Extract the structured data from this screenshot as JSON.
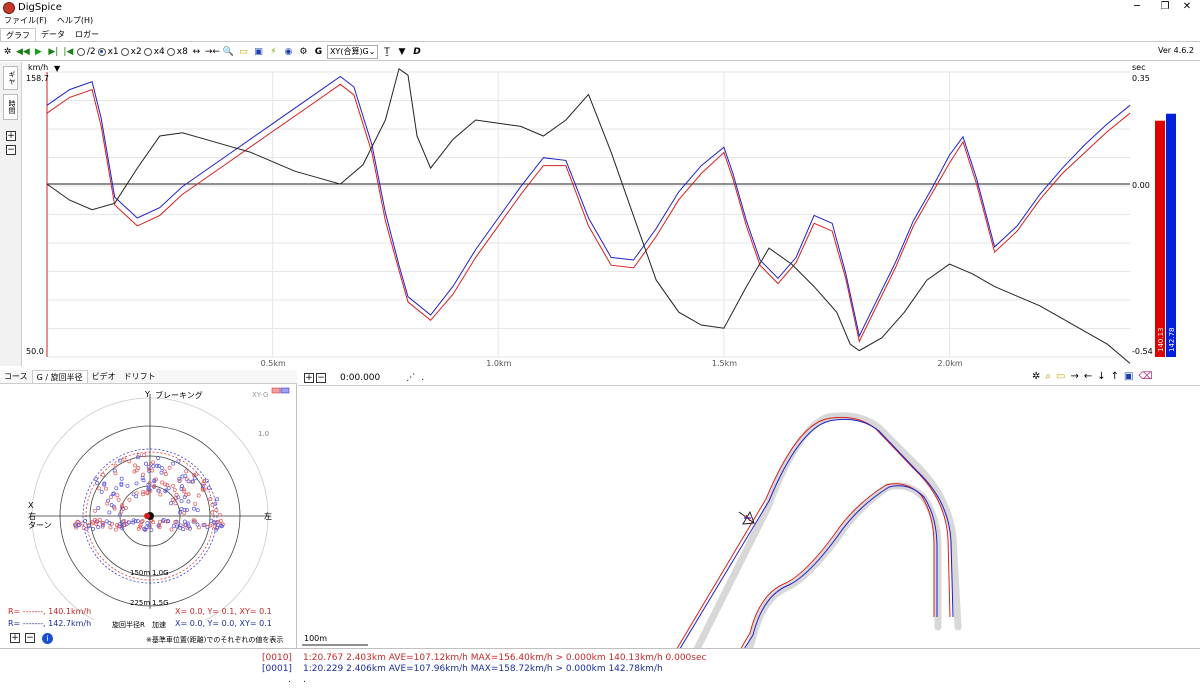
{
  "window": {
    "title": "DigSpice",
    "minimize": "─",
    "maximize": "❐",
    "close": "✕"
  },
  "menu": [
    {
      "label": "ファイル(F)"
    },
    {
      "label": "ヘルプ(H)"
    }
  ],
  "tabs": [
    {
      "label": "グラフ"
    },
    {
      "label": "データ"
    },
    {
      "label": "ロガー"
    }
  ],
  "toolbar": {
    "speeds": [
      {
        "label": "/2",
        "selected": false
      },
      {
        "label": "x1",
        "selected": true
      },
      {
        "label": "x2",
        "selected": false
      },
      {
        "label": "x4",
        "selected": false
      },
      {
        "label": "x8",
        "selected": false
      }
    ],
    "g_label": "G",
    "xy_select": "XY(合算)G",
    "version": "Ver 4.6.2",
    "icons": [
      "reset-icon",
      "rewind-icon",
      "play-icon",
      "step-forward-icon",
      "step-back-icon",
      "fit-width-icon",
      "shrink-width-icon",
      "search-icon",
      "open-folder-icon",
      "save-icon",
      "magic-icon",
      "globe-icon",
      "settings-icon"
    ]
  },
  "graph": {
    "left_unit": "km/h",
    "left_top": "158.7",
    "left_bottom": "50.0",
    "right_unit": "sec",
    "right_top": "0.35",
    "right_mid": "0.00",
    "right_bottom": "-0.54",
    "side_tabs": [
      "ギヤ",
      "時間"
    ],
    "x_ticks": [
      "0.5km",
      "1.0km",
      "1.5km",
      "2.0km"
    ],
    "bar_red_label": "140.13",
    "bar_blue_label": "142.78",
    "colors": {
      "red": "#d62020",
      "blue": "#2020c8",
      "black": "#222222"
    }
  },
  "chart_data": {
    "type": "line",
    "xlabel": "",
    "ylabel": "km/h",
    "x_unit": "km",
    "xlim": [
      0,
      2.4
    ],
    "ylim": [
      50.0,
      158.7
    ],
    "y2lim": [
      -0.54,
      0.35
    ],
    "series": [
      {
        "name": "",
        "color": "#d62020",
        "axis": "speed",
        "x": [
          0,
          0.05,
          0.1,
          0.12,
          0.15,
          0.2,
          0.25,
          0.3,
          0.4,
          0.5,
          0.6,
          0.65,
          0.68,
          0.72,
          0.75,
          0.78,
          0.8,
          0.85,
          0.9,
          0.95,
          1.0,
          1.05,
          1.1,
          1.15,
          1.2,
          1.25,
          1.3,
          1.35,
          1.4,
          1.45,
          1.5,
          1.52,
          1.55,
          1.58,
          1.62,
          1.66,
          1.7,
          1.74,
          1.77,
          1.8,
          1.84,
          1.88,
          1.92,
          1.96,
          2.0,
          2.03,
          2.06,
          2.1,
          2.15,
          2.2,
          2.25,
          2.3,
          2.35,
          2.4
        ],
        "y": [
          143,
          149,
          152,
          138,
          108,
          100,
          104,
          112,
          124,
          136,
          148,
          154,
          150,
          128,
          102,
          83,
          71,
          64,
          74,
          88,
          100,
          112,
          123,
          123,
          100,
          85,
          84,
          96,
          110,
          120,
          128,
          118,
          100,
          85,
          78,
          86,
          101,
          98,
          80,
          56,
          70,
          84,
          100,
          112,
          124,
          132,
          116,
          90,
          98,
          110,
          120,
          128,
          136,
          143
        ]
      },
      {
        "name": "",
        "color": "#2020c8",
        "axis": "speed",
        "x": [
          0,
          0.05,
          0.1,
          0.12,
          0.15,
          0.2,
          0.25,
          0.3,
          0.4,
          0.5,
          0.6,
          0.65,
          0.68,
          0.72,
          0.75,
          0.78,
          0.8,
          0.85,
          0.9,
          0.95,
          1.0,
          1.05,
          1.1,
          1.15,
          1.2,
          1.25,
          1.3,
          1.35,
          1.4,
          1.45,
          1.5,
          1.52,
          1.55,
          1.58,
          1.62,
          1.66,
          1.7,
          1.74,
          1.77,
          1.8,
          1.84,
          1.88,
          1.92,
          1.96,
          2.0,
          2.03,
          2.06,
          2.1,
          2.15,
          2.2,
          2.25,
          2.3,
          2.35,
          2.4
        ],
        "y": [
          146,
          152,
          155,
          141,
          111,
          103,
          107,
          115,
          127,
          139,
          151,
          157,
          153,
          131,
          105,
          85,
          73,
          66,
          77,
          91,
          103,
          115,
          126,
          125,
          103,
          88,
          87,
          99,
          113,
          123,
          130,
          120,
          102,
          87,
          80,
          88,
          104,
          101,
          82,
          58,
          72,
          86,
          102,
          114,
          127,
          134,
          118,
          92,
          100,
          112,
          122,
          131,
          139,
          146
        ]
      },
      {
        "name": "",
        "color": "#222222",
        "axis": "time",
        "x": [
          0,
          0.05,
          0.1,
          0.15,
          0.2,
          0.25,
          0.3,
          0.35,
          0.4,
          0.45,
          0.5,
          0.55,
          0.6,
          0.65,
          0.7,
          0.75,
          0.78,
          0.8,
          0.82,
          0.85,
          0.9,
          0.95,
          1.0,
          1.05,
          1.1,
          1.15,
          1.2,
          1.25,
          1.3,
          1.35,
          1.4,
          1.45,
          1.5,
          1.55,
          1.6,
          1.65,
          1.7,
          1.75,
          1.78,
          1.8,
          1.85,
          1.9,
          1.95,
          2.0,
          2.05,
          2.1,
          2.15,
          2.2,
          2.25,
          2.3,
          2.35,
          2.4
        ],
        "y": [
          0.0,
          -0.05,
          -0.08,
          -0.06,
          0.05,
          0.15,
          0.16,
          0.14,
          0.12,
          0.1,
          0.07,
          0.04,
          0.02,
          0.0,
          0.06,
          0.2,
          0.36,
          0.34,
          0.15,
          0.05,
          0.14,
          0.2,
          0.19,
          0.18,
          0.15,
          0.2,
          0.28,
          0.1,
          -0.1,
          -0.3,
          -0.4,
          -0.44,
          -0.45,
          -0.32,
          -0.2,
          -0.25,
          -0.32,
          -0.4,
          -0.5,
          -0.52,
          -0.48,
          -0.4,
          -0.3,
          -0.25,
          -0.28,
          -0.32,
          -0.35,
          -0.38,
          -0.42,
          -0.46,
          -0.5,
          -0.56
        ]
      }
    ]
  },
  "gg": {
    "tabs": [
      {
        "label": "コース"
      },
      {
        "label": "G / 旋回半径"
      },
      {
        "label": "ビデオ"
      },
      {
        "label": "ドリフト"
      }
    ],
    "y_label": "Y",
    "brake_label": "ブレーキング",
    "x_label": "X",
    "right_turn": "右",
    "turn_label": "ターン",
    "left_label": "左",
    "accel_label": "加速",
    "radius_label": "旋回半径R",
    "ring_150": "150m",
    "ring_1g": "1.0G",
    "ring_225": "225m",
    "ring_15g": "1.5G",
    "outer_1g": "1.0",
    "xy_tag": "XY-G",
    "readout_red": {
      "r": "R= -------, 140.1km/h",
      "xy": "X=  0.0, Y=  0.1, XY= 0.1"
    },
    "readout_blue": {
      "r": "R= -------, 142.7km/h",
      "xy": "X=  0.0, Y=  0.0, XY= 0.1"
    },
    "note": "※基準車位置(距離)でのそれぞれの値を表示"
  },
  "map": {
    "time": "0:00.000",
    "dot": ".",
    "scale": "100m",
    "icons": [
      "reset-icon",
      "search-icon",
      "open-folder-icon",
      "arrow-right-icon",
      "arrow-left-icon",
      "arrow-down-icon",
      "arrow-up-icon",
      "save-icon",
      "eraser-icon"
    ]
  },
  "status": {
    "red_id": "[0010]",
    "red_text": "1:20.767 2.403km AVE=107.12km/h MAX=156.40km/h > 0.000km 140.13km/h 0.000sec",
    "blue_id": "[0001]",
    "blue_text": "1:20.229 2.406km AVE=107.96km/h MAX=158.72km/h > 0.000km 142.78km/h",
    "dot1": ".",
    "dot2": "."
  }
}
